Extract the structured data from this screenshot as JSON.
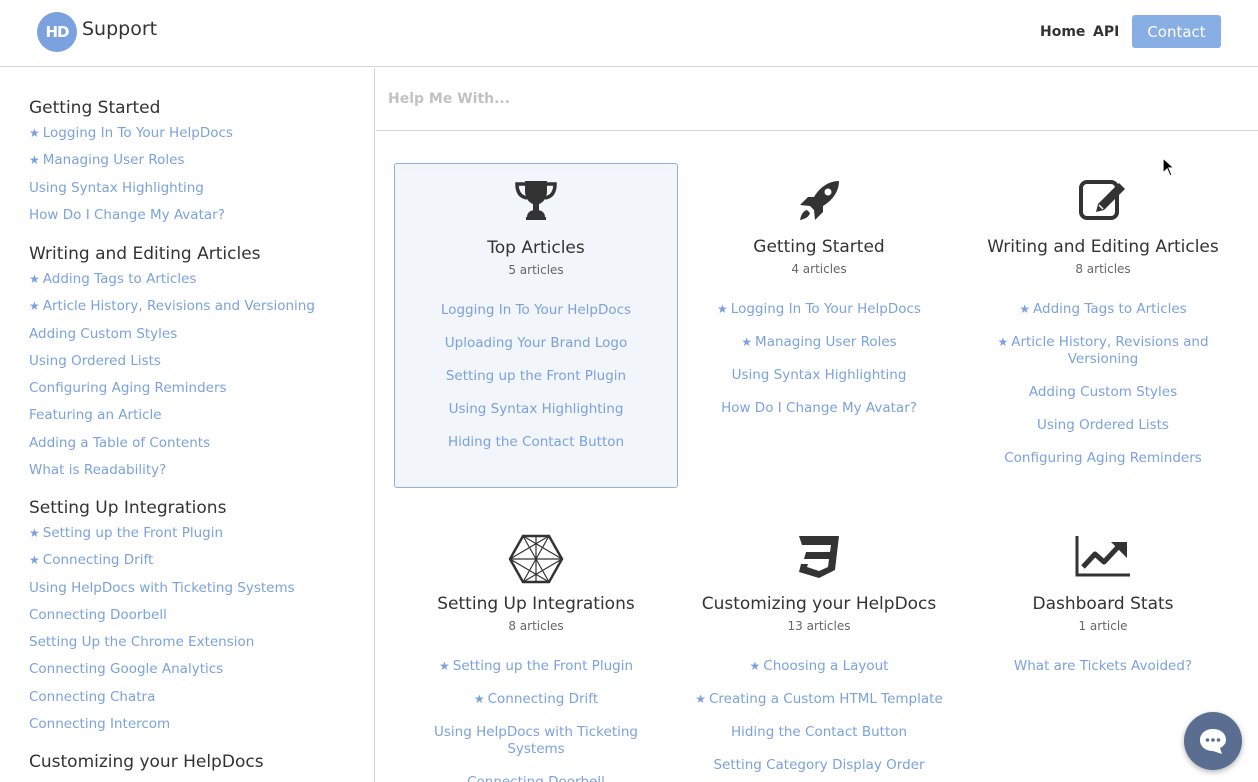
{
  "header": {
    "logo_text": "HD",
    "brand": "Support",
    "nav": [
      "Home",
      "API"
    ],
    "contact_label": "Contact"
  },
  "sidebar": {
    "sections": [
      {
        "title": "Getting Started",
        "items": [
          {
            "label": "Logging In To Your HelpDocs",
            "starred": true
          },
          {
            "label": "Managing User Roles",
            "starred": true
          },
          {
            "label": "Using Syntax Highlighting",
            "starred": false
          },
          {
            "label": "How Do I Change My Avatar?",
            "starred": false
          }
        ]
      },
      {
        "title": "Writing and Editing Articles",
        "items": [
          {
            "label": "Adding Tags to Articles",
            "starred": true
          },
          {
            "label": "Article History, Revisions and Versioning",
            "starred": true
          },
          {
            "label": "Adding Custom Styles",
            "starred": false
          },
          {
            "label": "Using Ordered Lists",
            "starred": false
          },
          {
            "label": "Configuring Aging Reminders",
            "starred": false
          },
          {
            "label": "Featuring an Article",
            "starred": false
          },
          {
            "label": "Adding a Table of Contents",
            "starred": false
          },
          {
            "label": "What is Readability?",
            "starred": false
          }
        ]
      },
      {
        "title": "Setting Up Integrations",
        "items": [
          {
            "label": "Setting up the Front Plugin",
            "starred": true
          },
          {
            "label": "Connecting Drift",
            "starred": true
          },
          {
            "label": "Using HelpDocs with Ticketing Systems",
            "starred": false
          },
          {
            "label": "Connecting Doorbell",
            "starred": false
          },
          {
            "label": "Setting Up the Chrome Extension",
            "starred": false
          },
          {
            "label": "Connecting Google Analytics",
            "starred": false
          },
          {
            "label": "Connecting Chatra",
            "starred": false
          },
          {
            "label": "Connecting Intercom",
            "starred": false
          }
        ]
      },
      {
        "title": "Customizing your HelpDocs",
        "items": []
      }
    ]
  },
  "search": {
    "placeholder": "Help Me With..."
  },
  "cards": [
    {
      "icon": "trophy-icon",
      "title": "Top Articles",
      "count": "5 articles",
      "items": [
        {
          "label": "Logging In To Your HelpDocs",
          "starred": false
        },
        {
          "label": "Uploading Your Brand Logo",
          "starred": false
        },
        {
          "label": "Setting up the Front Plugin",
          "starred": false
        },
        {
          "label": "Using Syntax Highlighting",
          "starred": false
        },
        {
          "label": "Hiding the Contact Button",
          "starred": false
        }
      ]
    },
    {
      "icon": "rocket-icon",
      "title": "Getting Started",
      "count": "4 articles",
      "items": [
        {
          "label": "Logging In To Your HelpDocs",
          "starred": true
        },
        {
          "label": "Managing User Roles",
          "starred": true
        },
        {
          "label": "Using Syntax Highlighting",
          "starred": false
        },
        {
          "label": "How Do I Change My Avatar?",
          "starred": false
        }
      ]
    },
    {
      "icon": "edit-icon",
      "title": "Writing and Editing Articles",
      "count": "8 articles",
      "items": [
        {
          "label": "Adding Tags to Articles",
          "starred": true
        },
        {
          "label": "Article History, Revisions and Versioning",
          "starred": true
        },
        {
          "label": "Adding Custom Styles",
          "starred": false
        },
        {
          "label": "Using Ordered Lists",
          "starred": false
        },
        {
          "label": "Configuring Aging Reminders",
          "starred": false
        }
      ]
    },
    {
      "icon": "hexagon-network-icon",
      "title": "Setting Up Integrations",
      "count": "8 articles",
      "items": [
        {
          "label": "Setting up the Front Plugin",
          "starred": true
        },
        {
          "label": "Connecting Drift",
          "starred": true
        },
        {
          "label": "Using HelpDocs with Ticketing Systems",
          "starred": false
        },
        {
          "label": "Connecting Doorbell",
          "starred": false
        }
      ]
    },
    {
      "icon": "css3-icon",
      "title": "Customizing your HelpDocs",
      "count": "13 articles",
      "items": [
        {
          "label": "Choosing a Layout",
          "starred": true
        },
        {
          "label": "Creating a Custom HTML Template",
          "starred": true
        },
        {
          "label": "Hiding the Contact Button",
          "starred": false
        },
        {
          "label": "Setting Category Display Order",
          "starred": false
        }
      ]
    },
    {
      "icon": "line-chart-icon",
      "title": "Dashboard Stats",
      "count": "1 article",
      "items": [
        {
          "label": "What are Tickets Avoided?",
          "starred": false
        }
      ]
    }
  ],
  "colors": {
    "accent": "#7ba2de",
    "contact_button": "#88aee6",
    "active_card_bg": "#f2f5f9",
    "chat_button": "#5a6e91"
  }
}
